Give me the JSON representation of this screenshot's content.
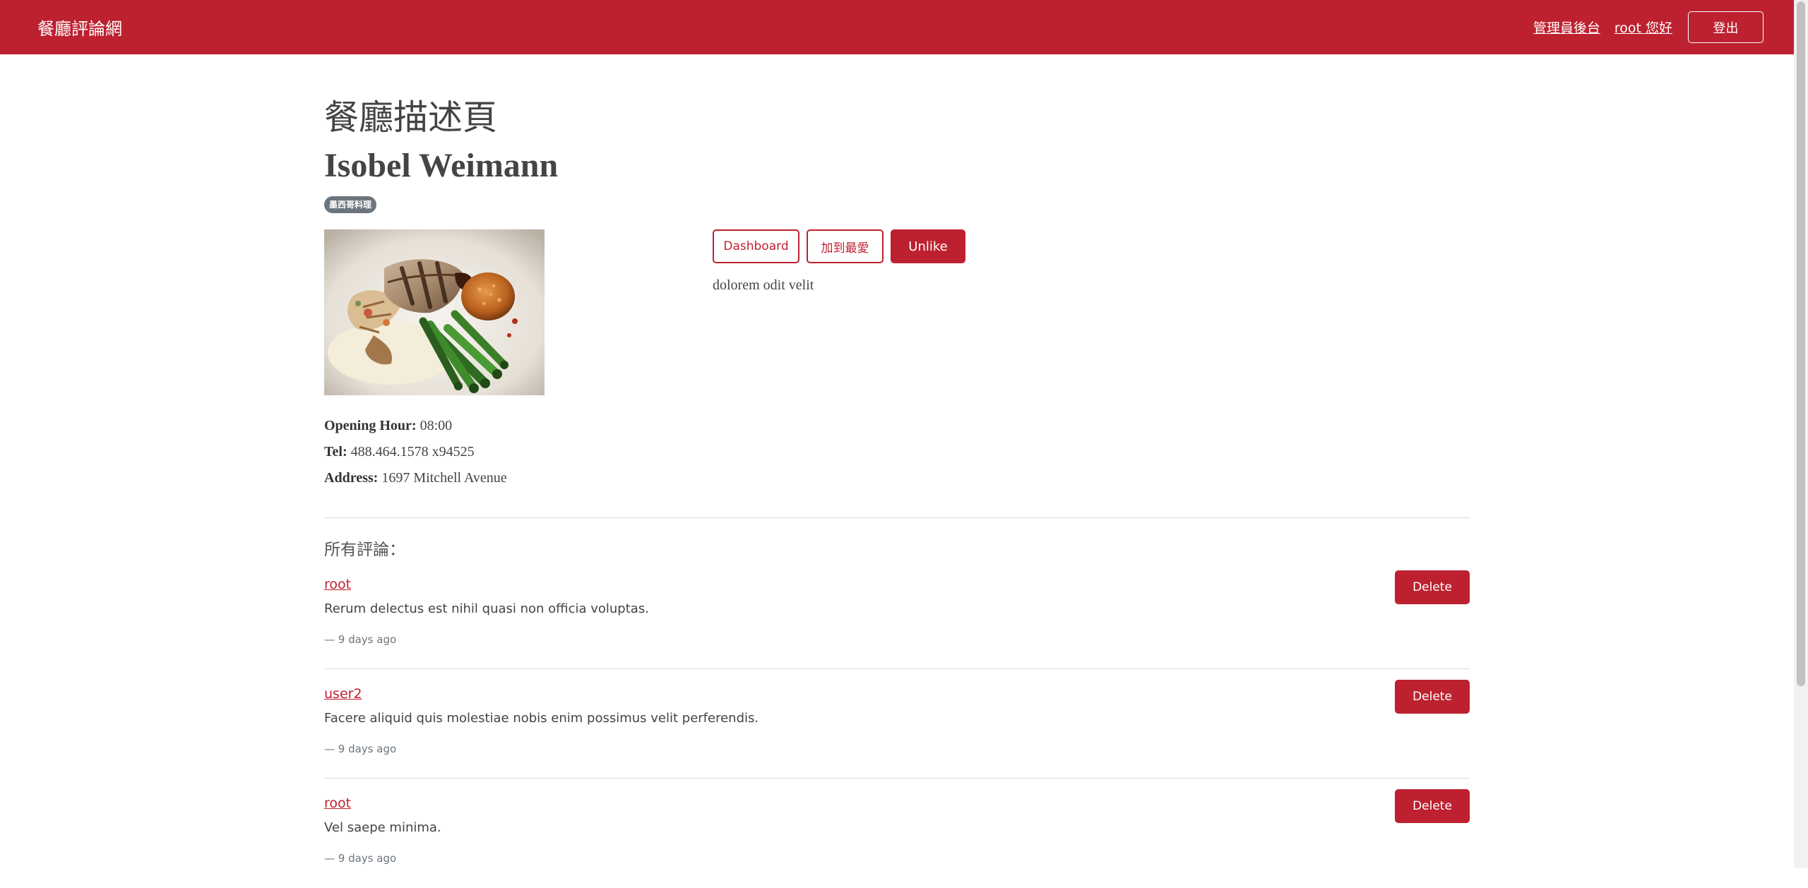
{
  "navbar": {
    "brand": "餐廳評論網",
    "admin_link": "管理員後台",
    "greeting_link": "root 您好",
    "logout_button": "登出"
  },
  "page": {
    "heading": "餐廳描述頁"
  },
  "restaurant": {
    "name": "Isobel Weimann",
    "category": "墨西哥料理",
    "image_icon": "plated-steak-asparagus-photo",
    "opening_hour_label": "Opening Hour:",
    "opening_hour": "08:00",
    "tel_label": "Tel:",
    "tel": "488.464.1578 x94525",
    "address_label": "Address:",
    "address": "1697 Mitchell Avenue",
    "description": "dolorem odit velit"
  },
  "actions": {
    "dashboard": "Dashboard",
    "favorite": "加到最愛",
    "unlike": "Unlike"
  },
  "comments": {
    "heading": "所有評論：",
    "delete_label": "Delete",
    "items": [
      {
        "user": "root",
        "text": "Rerum delectus est nihil quasi non officia voluptas.",
        "time": "— 9 days ago"
      },
      {
        "user": "user2",
        "text": "Facere aliquid quis molestiae nobis enim possimus velit perferendis.",
        "time": "— 9 days ago"
      },
      {
        "user": "root",
        "text": "Vel saepe minima.",
        "time": "— 9 days ago"
      }
    ]
  },
  "colors": {
    "brand_red": "#bd2130",
    "badge_gray": "#6c757d"
  }
}
